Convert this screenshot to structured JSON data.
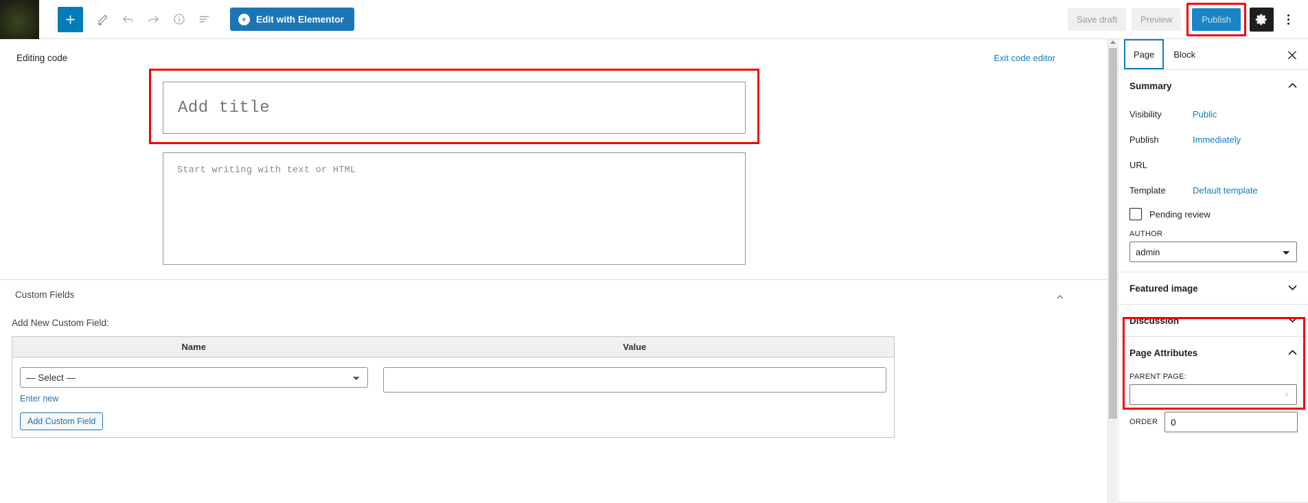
{
  "topbar": {
    "site_icon_name": "site-logo",
    "add_block_label": "+",
    "tools": [
      {
        "name": "add-block-button",
        "label": "+"
      },
      {
        "name": "edit-pencil-button",
        "label": ""
      },
      {
        "name": "undo-button",
        "label": ""
      },
      {
        "name": "redo-button",
        "label": ""
      },
      {
        "name": "details-info-button",
        "label": ""
      },
      {
        "name": "list-view-button",
        "label": ""
      }
    ],
    "elementor_button": "Edit with Elementor",
    "elementor_badge": "e",
    "save_draft": "Save draft",
    "preview": "Preview",
    "publish": "Publish",
    "settings_icon": "gear-icon",
    "options_icon": "kebab-menu-icon",
    "accent_blue": "#1b84c6",
    "highlight_red": "#f40000"
  },
  "editor": {
    "mode_label": "Editing code",
    "exit_link": "Exit code editor",
    "title_placeholder": "Add title",
    "title_value": "",
    "content_placeholder": "Start writing with text or HTML",
    "content_value": ""
  },
  "custom_fields": {
    "panel_title": "Custom Fields",
    "add_new_label": "Add New Custom Field:",
    "columns": [
      "Name",
      "Value"
    ],
    "name_select_value": "— Select —",
    "name_select_options": [
      "— Select —"
    ],
    "enter_new_link": "Enter new",
    "add_button": "Add Custom Field",
    "value_text": "",
    "collapse_icon": "chevron-up-icon"
  },
  "sidebar": {
    "tabs": [
      {
        "label": "Page",
        "active": true
      },
      {
        "label": "Block",
        "active": false
      }
    ],
    "close_icon": "close-icon",
    "summary": {
      "title": "Summary",
      "expanded": true,
      "rows": [
        {
          "key": "Visibility",
          "value": "Public"
        },
        {
          "key": "Publish",
          "value": "Immediately"
        },
        {
          "key": "URL",
          "value": ""
        },
        {
          "key": "Template",
          "value": "Default template"
        }
      ],
      "pending_review_label": "Pending review",
      "pending_review_checked": false,
      "author_label": "AUTHOR",
      "author_value": "admin",
      "author_options": [
        "admin"
      ]
    },
    "featured_image": {
      "title": "Featured image",
      "expanded": false
    },
    "discussion": {
      "title": "Discussion",
      "expanded": false
    },
    "page_attributes": {
      "title": "Page Attributes",
      "expanded": true,
      "parent_page_label": "PARENT PAGE:",
      "parent_page_value": "",
      "clear_icon": "clear-x-icon",
      "order_label": "ORDER",
      "order_value": "0"
    }
  }
}
